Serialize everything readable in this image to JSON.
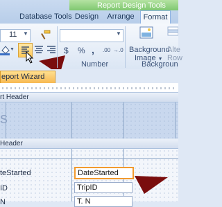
{
  "ribbon": {
    "contextual_title": "Report Design Tools",
    "tabs": [
      "Database Tools",
      "Design",
      "Arrange",
      "Format"
    ],
    "font_size": "11",
    "number_format": "",
    "number_symbols": [
      "$",
      "%",
      ","
    ],
    "decimal_symbols": [
      ".00",
      "→.0"
    ],
    "background_image_label_line1": "Background",
    "background_image_label_line2": "Image",
    "alternate_row_label_line1": "Alte",
    "alternate_row_label_line2": "Row",
    "group_number": "Number",
    "group_background": "Backgroun"
  },
  "document": {
    "tab_label": "eport Wizard"
  },
  "sections": {
    "report_header": "rt Header",
    "page_header": "Header",
    "report_header_text": "s"
  },
  "fields": {
    "date_label": "teStarted",
    "date_field": "DateStarted",
    "trip_label": "ID",
    "trip_field": "TripID",
    "next_label": "N",
    "next_field": "T. N"
  },
  "colors": {
    "arrow": "#7a0d0d",
    "selected_border": "#f29a2e",
    "contextual_band": "#8fce7c"
  }
}
